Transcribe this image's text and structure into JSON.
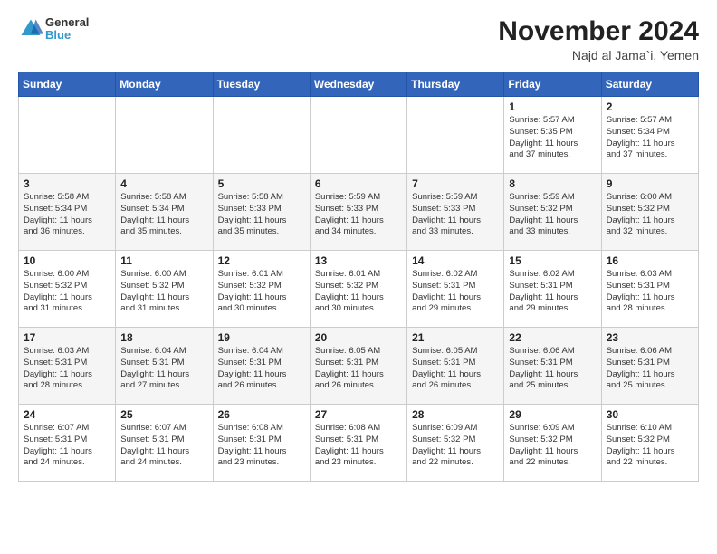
{
  "header": {
    "logo_general": "General",
    "logo_blue": "Blue",
    "month_title": "November 2024",
    "location": "Najd al Jama`i, Yemen"
  },
  "calendar": {
    "days_of_week": [
      "Sunday",
      "Monday",
      "Tuesday",
      "Wednesday",
      "Thursday",
      "Friday",
      "Saturday"
    ],
    "weeks": [
      [
        {
          "day": "",
          "info": ""
        },
        {
          "day": "",
          "info": ""
        },
        {
          "day": "",
          "info": ""
        },
        {
          "day": "",
          "info": ""
        },
        {
          "day": "",
          "info": ""
        },
        {
          "day": "1",
          "info": "Sunrise: 5:57 AM\nSunset: 5:35 PM\nDaylight: 11 hours\nand 37 minutes."
        },
        {
          "day": "2",
          "info": "Sunrise: 5:57 AM\nSunset: 5:34 PM\nDaylight: 11 hours\nand 37 minutes."
        }
      ],
      [
        {
          "day": "3",
          "info": "Sunrise: 5:58 AM\nSunset: 5:34 PM\nDaylight: 11 hours\nand 36 minutes."
        },
        {
          "day": "4",
          "info": "Sunrise: 5:58 AM\nSunset: 5:34 PM\nDaylight: 11 hours\nand 35 minutes."
        },
        {
          "day": "5",
          "info": "Sunrise: 5:58 AM\nSunset: 5:33 PM\nDaylight: 11 hours\nand 35 minutes."
        },
        {
          "day": "6",
          "info": "Sunrise: 5:59 AM\nSunset: 5:33 PM\nDaylight: 11 hours\nand 34 minutes."
        },
        {
          "day": "7",
          "info": "Sunrise: 5:59 AM\nSunset: 5:33 PM\nDaylight: 11 hours\nand 33 minutes."
        },
        {
          "day": "8",
          "info": "Sunrise: 5:59 AM\nSunset: 5:32 PM\nDaylight: 11 hours\nand 33 minutes."
        },
        {
          "day": "9",
          "info": "Sunrise: 6:00 AM\nSunset: 5:32 PM\nDaylight: 11 hours\nand 32 minutes."
        }
      ],
      [
        {
          "day": "10",
          "info": "Sunrise: 6:00 AM\nSunset: 5:32 PM\nDaylight: 11 hours\nand 31 minutes."
        },
        {
          "day": "11",
          "info": "Sunrise: 6:00 AM\nSunset: 5:32 PM\nDaylight: 11 hours\nand 31 minutes."
        },
        {
          "day": "12",
          "info": "Sunrise: 6:01 AM\nSunset: 5:32 PM\nDaylight: 11 hours\nand 30 minutes."
        },
        {
          "day": "13",
          "info": "Sunrise: 6:01 AM\nSunset: 5:32 PM\nDaylight: 11 hours\nand 30 minutes."
        },
        {
          "day": "14",
          "info": "Sunrise: 6:02 AM\nSunset: 5:31 PM\nDaylight: 11 hours\nand 29 minutes."
        },
        {
          "day": "15",
          "info": "Sunrise: 6:02 AM\nSunset: 5:31 PM\nDaylight: 11 hours\nand 29 minutes."
        },
        {
          "day": "16",
          "info": "Sunrise: 6:03 AM\nSunset: 5:31 PM\nDaylight: 11 hours\nand 28 minutes."
        }
      ],
      [
        {
          "day": "17",
          "info": "Sunrise: 6:03 AM\nSunset: 5:31 PM\nDaylight: 11 hours\nand 28 minutes."
        },
        {
          "day": "18",
          "info": "Sunrise: 6:04 AM\nSunset: 5:31 PM\nDaylight: 11 hours\nand 27 minutes."
        },
        {
          "day": "19",
          "info": "Sunrise: 6:04 AM\nSunset: 5:31 PM\nDaylight: 11 hours\nand 26 minutes."
        },
        {
          "day": "20",
          "info": "Sunrise: 6:05 AM\nSunset: 5:31 PM\nDaylight: 11 hours\nand 26 minutes."
        },
        {
          "day": "21",
          "info": "Sunrise: 6:05 AM\nSunset: 5:31 PM\nDaylight: 11 hours\nand 26 minutes."
        },
        {
          "day": "22",
          "info": "Sunrise: 6:06 AM\nSunset: 5:31 PM\nDaylight: 11 hours\nand 25 minutes."
        },
        {
          "day": "23",
          "info": "Sunrise: 6:06 AM\nSunset: 5:31 PM\nDaylight: 11 hours\nand 25 minutes."
        }
      ],
      [
        {
          "day": "24",
          "info": "Sunrise: 6:07 AM\nSunset: 5:31 PM\nDaylight: 11 hours\nand 24 minutes."
        },
        {
          "day": "25",
          "info": "Sunrise: 6:07 AM\nSunset: 5:31 PM\nDaylight: 11 hours\nand 24 minutes."
        },
        {
          "day": "26",
          "info": "Sunrise: 6:08 AM\nSunset: 5:31 PM\nDaylight: 11 hours\nand 23 minutes."
        },
        {
          "day": "27",
          "info": "Sunrise: 6:08 AM\nSunset: 5:31 PM\nDaylight: 11 hours\nand 23 minutes."
        },
        {
          "day": "28",
          "info": "Sunrise: 6:09 AM\nSunset: 5:32 PM\nDaylight: 11 hours\nand 22 minutes."
        },
        {
          "day": "29",
          "info": "Sunrise: 6:09 AM\nSunset: 5:32 PM\nDaylight: 11 hours\nand 22 minutes."
        },
        {
          "day": "30",
          "info": "Sunrise: 6:10 AM\nSunset: 5:32 PM\nDaylight: 11 hours\nand 22 minutes."
        }
      ]
    ]
  }
}
